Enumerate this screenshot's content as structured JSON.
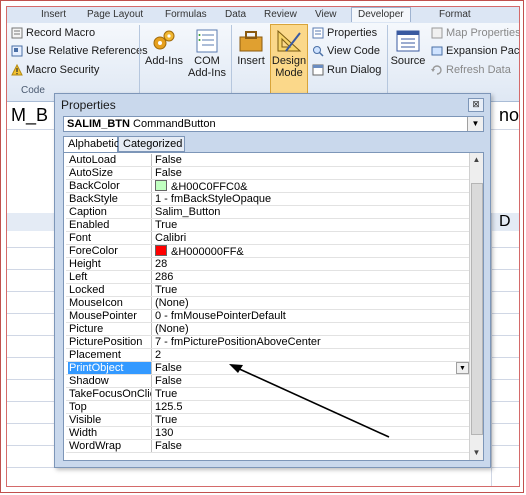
{
  "ribbon": {
    "tabs": [
      "Insert",
      "Page Layout",
      "Formulas",
      "Data",
      "Review",
      "View",
      "Developer",
      "Format"
    ],
    "code_group": {
      "label": "Code",
      "record_macro": "Record Macro",
      "use_relative_refs": "Use Relative References",
      "macro_security": "Macro Security"
    },
    "add_ins": "Add-Ins",
    "com_add_ins_line1": "COM",
    "com_add_ins_line2": "Add-Ins",
    "insert": "Insert",
    "design_mode_line1": "Design",
    "design_mode_line2": "Mode",
    "properties": "Properties",
    "view_code": "View Code",
    "run_dialog": "Run Dialog",
    "source": "Source",
    "map_properties": "Map Properties",
    "expansion_packs": "Expansion Packs",
    "refresh_data": "Refresh Data"
  },
  "sheet": {
    "left_fragment": "M_B",
    "right_fragment": "no",
    "col_d": "D"
  },
  "properties_window": {
    "title": "Properties",
    "close_glyph": "⊠",
    "object_name": "SALIM_BTN",
    "object_type": "CommandButton",
    "tabs": [
      "Alphabetic",
      "Categorized"
    ],
    "rows": [
      {
        "name": "AutoLoad",
        "value": "False"
      },
      {
        "name": "AutoSize",
        "value": "False"
      },
      {
        "name": "BackColor",
        "value": "&H00C0FFC0&",
        "swatch": "#c0ffc0"
      },
      {
        "name": "BackStyle",
        "value": "1 - fmBackStyleOpaque"
      },
      {
        "name": "Caption",
        "value": "Salim_Button"
      },
      {
        "name": "Enabled",
        "value": "True"
      },
      {
        "name": "Font",
        "value": "Calibri"
      },
      {
        "name": "ForeColor",
        "value": "&H000000FF&",
        "swatch": "#ff0000"
      },
      {
        "name": "Height",
        "value": "28"
      },
      {
        "name": "Left",
        "value": "286"
      },
      {
        "name": "Locked",
        "value": "True"
      },
      {
        "name": "MouseIcon",
        "value": "(None)"
      },
      {
        "name": "MousePointer",
        "value": "0 - fmMousePointerDefault"
      },
      {
        "name": "Picture",
        "value": "(None)"
      },
      {
        "name": "PicturePosition",
        "value": "7 - fmPicturePositionAboveCenter"
      },
      {
        "name": "Placement",
        "value": "2"
      },
      {
        "name": "PrintObject",
        "value": "False",
        "selected": true
      },
      {
        "name": "Shadow",
        "value": "False"
      },
      {
        "name": "TakeFocusOnClick",
        "value": "True"
      },
      {
        "name": "Top",
        "value": "125.5"
      },
      {
        "name": "Visible",
        "value": "True"
      },
      {
        "name": "Width",
        "value": "130"
      },
      {
        "name": "WordWrap",
        "value": "False"
      }
    ]
  },
  "colors": {
    "selection": "#3399ff",
    "design_mode_highlight": "#fbd88a",
    "frame_border": "#c0504d"
  }
}
